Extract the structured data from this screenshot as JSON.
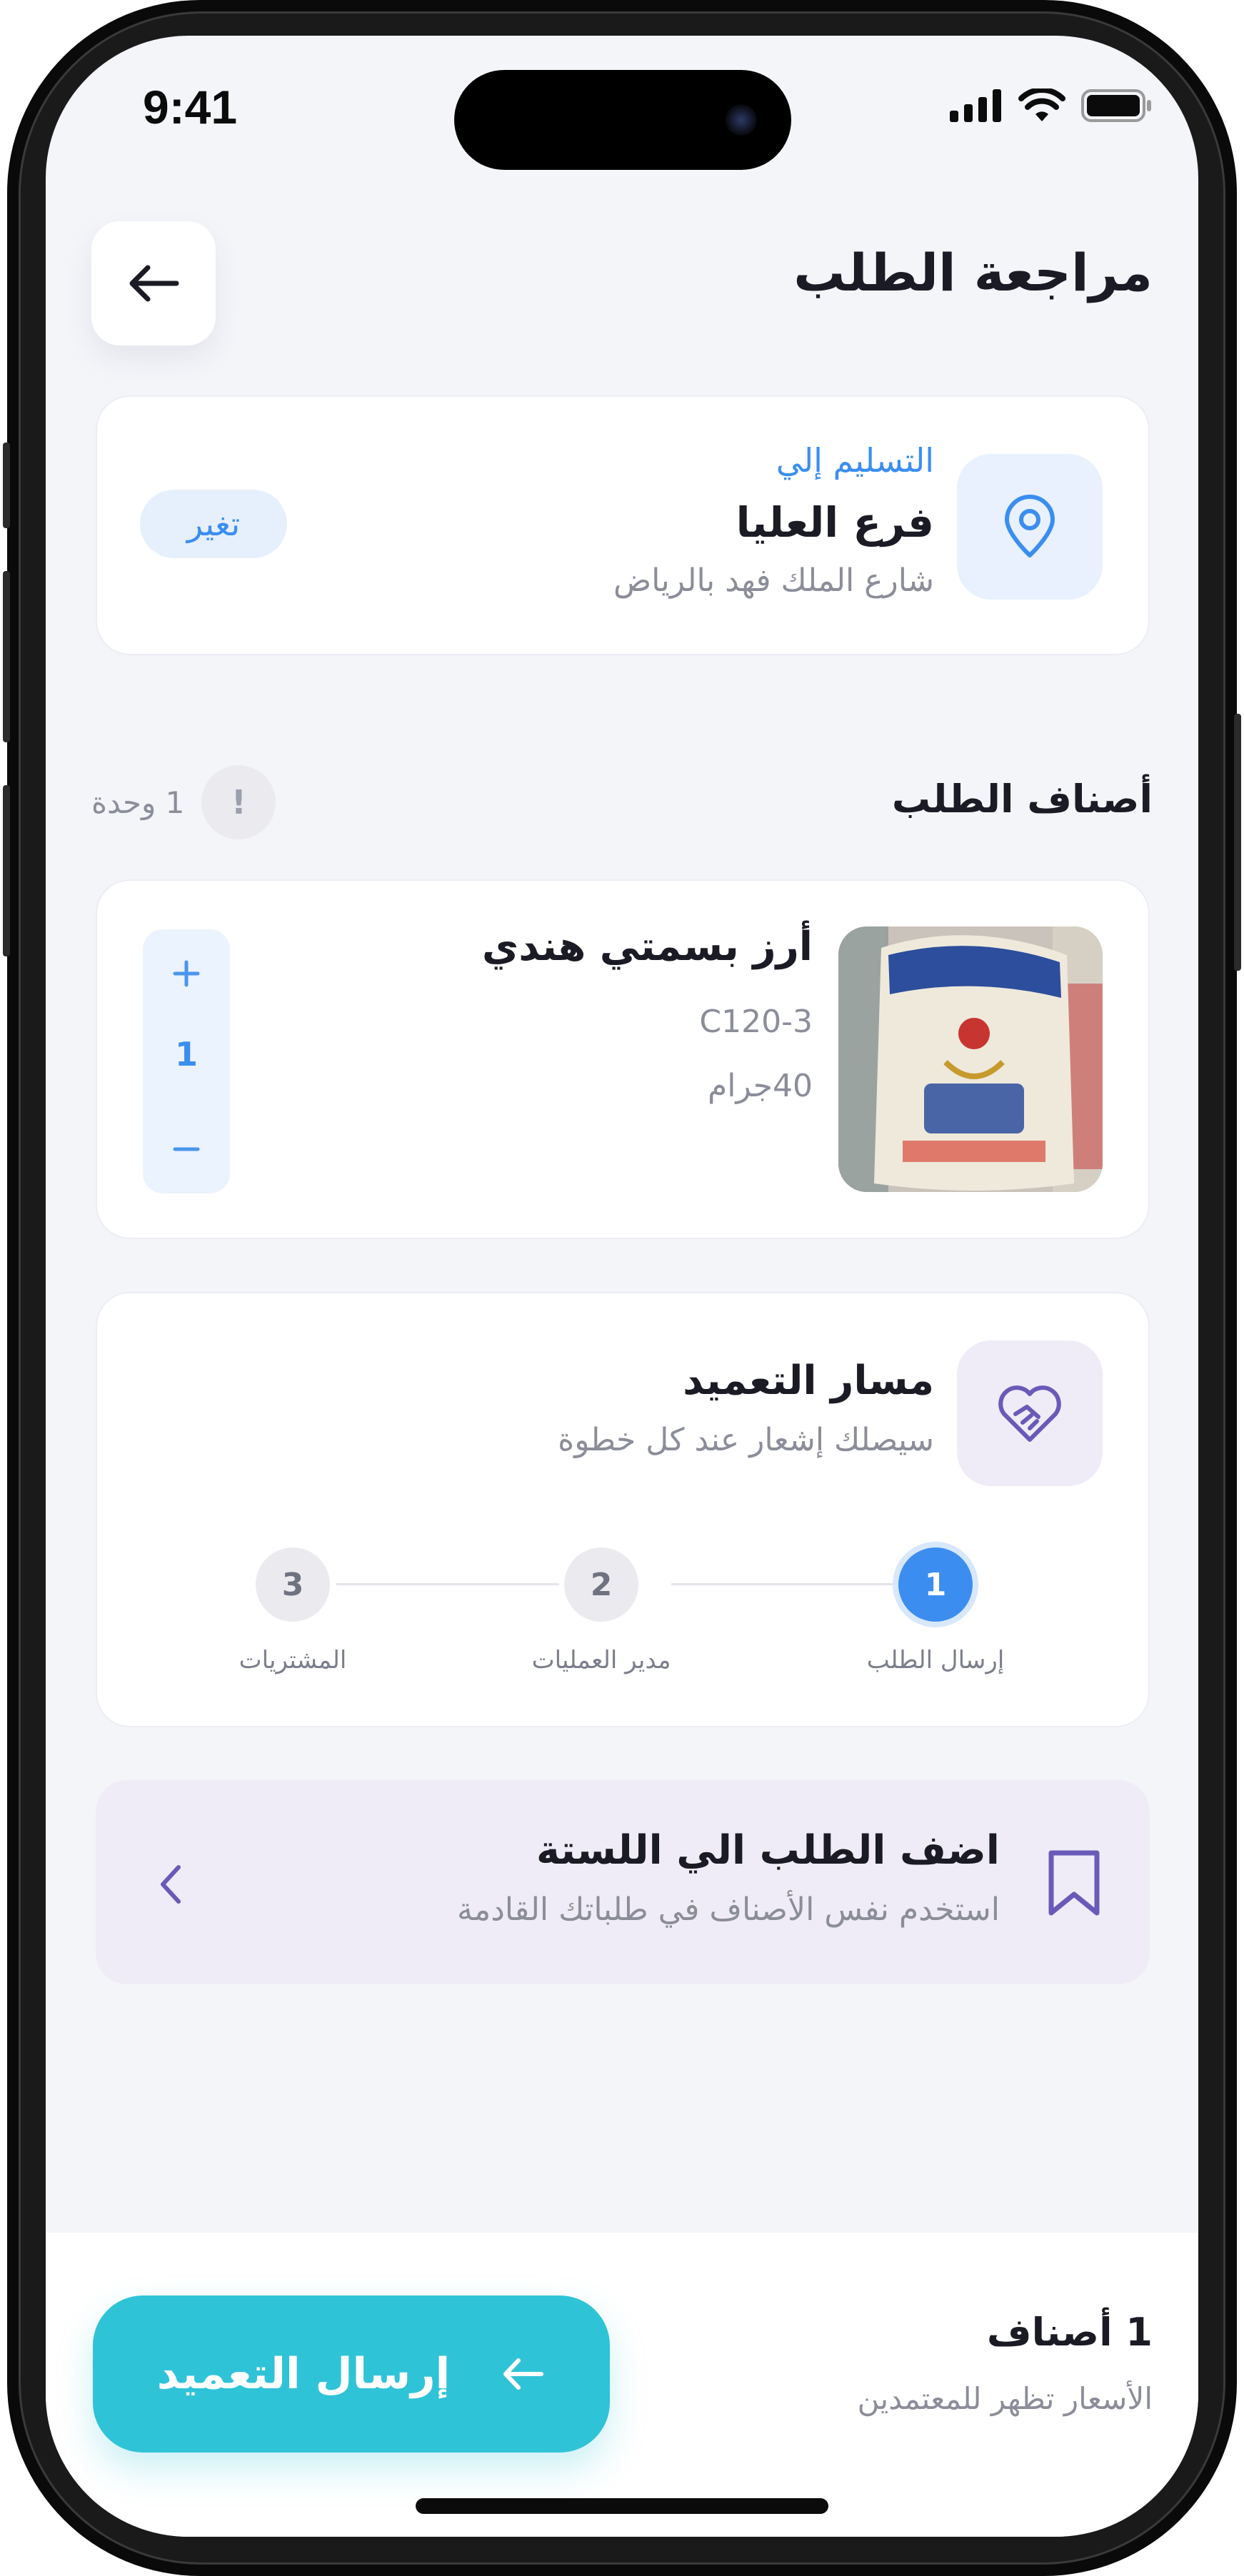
{
  "status_bar": {
    "time": "9:41"
  },
  "header": {
    "title": "مراجعة الطلب"
  },
  "delivery": {
    "label": "التسليم إلي",
    "branch": "فرع العليا",
    "address": "شارع الملك فهد بالرياض",
    "change_label": "تغير"
  },
  "items_section": {
    "title": "أصناف الطلب",
    "units": "1 وحدة",
    "info_glyph": "!"
  },
  "product": {
    "name": "أرز بسمتي هندي",
    "code": "C120-3",
    "weight": "40جرام",
    "quantity": "1",
    "quantity_fraction": 1
  },
  "approval": {
    "title": "مسار التعميد",
    "subtitle": "سيصلك إشعار عند كل خطوة",
    "steps": [
      {
        "number": "1",
        "label": "إرسال الطلب",
        "active": true
      },
      {
        "number": "2",
        "label": "مدير العمليات",
        "active": false
      },
      {
        "number": "3",
        "label": "المشتريات",
        "active": false
      }
    ]
  },
  "favorites": {
    "title": "اضف الطلب الي اللستة",
    "subtitle": "استخدم نفس الأصناف في طلباتك القادمة"
  },
  "footer": {
    "count": "1 أصناف",
    "note": "الأسعار تظهر للمعتمدين",
    "submit_label": "إرسال التعميد"
  },
  "colors": {
    "accent_blue": "#3b8ef0",
    "submit_teal": "#2fc3d8",
    "lavender": "#efecf7",
    "background": "#f4f5f9"
  }
}
